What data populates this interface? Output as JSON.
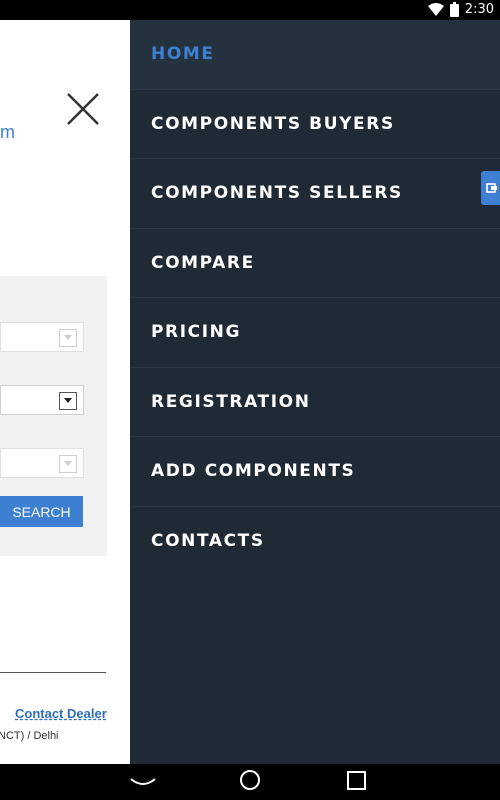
{
  "status_bar": {
    "time": "2:30",
    "icons": [
      "wifi-icon",
      "battery-icon"
    ]
  },
  "background_page": {
    "brand_fragment": "m",
    "search_button_label": "SEARCH",
    "contact_dealer_label": "Contact Dealer",
    "location_text": "NCT) / Delhi"
  },
  "drawer": {
    "items": [
      {
        "label": "HOME",
        "active": true
      },
      {
        "label": "COMPONENTS BUYERS",
        "active": false
      },
      {
        "label": "COMPONENTS SELLERS",
        "active": false
      },
      {
        "label": "COMPARE",
        "active": false
      },
      {
        "label": "PRICING",
        "active": false
      },
      {
        "label": "REGISTRATION",
        "active": false
      },
      {
        "label": "ADD COMPONENTS",
        "active": false
      },
      {
        "label": "CONTACTS",
        "active": false
      }
    ]
  },
  "nav_bar": {
    "buttons": [
      "back-icon",
      "home-icon",
      "recents-icon"
    ]
  },
  "colors": {
    "drawer_bg": "#1f2a35",
    "accent": "#3d7fd1",
    "drawer_text": "#ffffff"
  }
}
